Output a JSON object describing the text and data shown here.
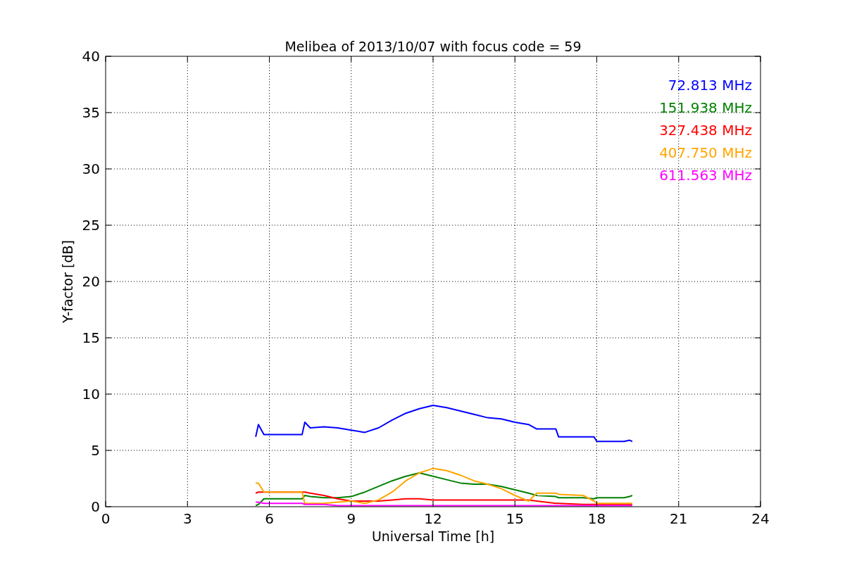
{
  "chart": {
    "chart_data": {
      "type": "line",
      "title": "Melibea of 2013/10/07 with focus code = 59",
      "xlabel": "Universal Time [h]",
      "ylabel": "Y-factor [dB]",
      "xlim": [
        0,
        24
      ],
      "ylim": [
        0,
        40
      ],
      "xticks": [
        0,
        3,
        6,
        9,
        12,
        15,
        18,
        21,
        24
      ],
      "yticks": [
        0,
        5,
        10,
        15,
        20,
        25,
        30,
        35,
        40
      ],
      "grid": true,
      "x": [
        5.5,
        5.6,
        5.8,
        7.2,
        7.3,
        7.5,
        8,
        8.5,
        9,
        9.5,
        10,
        10.5,
        11,
        11.5,
        12,
        12.5,
        13,
        13.5,
        14,
        14.5,
        15,
        15.5,
        15.8,
        16.5,
        16.6,
        17.5,
        17.9,
        18,
        19,
        19.2,
        19.3
      ],
      "series": [
        {
          "name": "72.813 MHz",
          "color": "#0000ff",
          "values": [
            6.2,
            7.3,
            6.4,
            6.4,
            7.5,
            7.0,
            7.1,
            7.0,
            6.8,
            6.6,
            7.0,
            7.7,
            8.3,
            8.7,
            9.0,
            8.8,
            8.5,
            8.2,
            7.9,
            7.8,
            7.5,
            7.3,
            6.9,
            6.9,
            6.2,
            6.2,
            6.2,
            5.8,
            5.8,
            5.9,
            5.8
          ]
        },
        {
          "name": "151.938 MHz",
          "color": "#008000",
          "values": [
            0.1,
            0.2,
            0.7,
            0.7,
            1.0,
            0.9,
            0.8,
            0.8,
            0.9,
            1.3,
            1.8,
            2.3,
            2.7,
            3.0,
            2.7,
            2.4,
            2.1,
            2.0,
            2.0,
            1.8,
            1.5,
            1.2,
            1.0,
            0.9,
            0.8,
            0.8,
            0.7,
            0.8,
            0.8,
            0.9,
            1.0
          ]
        },
        {
          "name": "327.438 MHz",
          "color": "#ff0000",
          "values": [
            1.2,
            1.3,
            1.3,
            1.3,
            1.3,
            1.2,
            1.0,
            0.7,
            0.5,
            0.5,
            0.5,
            0.6,
            0.7,
            0.7,
            0.6,
            0.6,
            0.6,
            0.6,
            0.6,
            0.6,
            0.6,
            0.6,
            0.5,
            0.3,
            0.3,
            0.2,
            0.2,
            0.2,
            0.2,
            0.2,
            0.2
          ]
        },
        {
          "name": "407.750 MHz",
          "color": "#ffa500",
          "values": [
            2.1,
            2.1,
            1.3,
            1.3,
            0.3,
            0.3,
            0.3,
            0.4,
            0.5,
            0.3,
            0.6,
            1.3,
            2.3,
            3.0,
            3.4,
            3.2,
            2.8,
            2.3,
            2.0,
            1.6,
            1.0,
            0.5,
            1.2,
            1.2,
            1.1,
            1.0,
            0.5,
            0.3,
            0.3,
            0.3,
            0.3
          ]
        },
        {
          "name": "611.563 MHz",
          "color": "#ff00ff",
          "values": [
            0.4,
            0.4,
            0.3,
            0.3,
            0.2,
            0.2,
            0.2,
            0.1,
            0.1,
            0.1,
            0.1,
            0.1,
            0.1,
            0.1,
            0.1,
            0.1,
            0.1,
            0.1,
            0.1,
            0.1,
            0.1,
            0.1,
            0.1,
            0.1,
            0.1,
            0.1,
            0.1,
            0.1,
            0.1,
            0.1,
            0.1
          ]
        }
      ]
    }
  }
}
